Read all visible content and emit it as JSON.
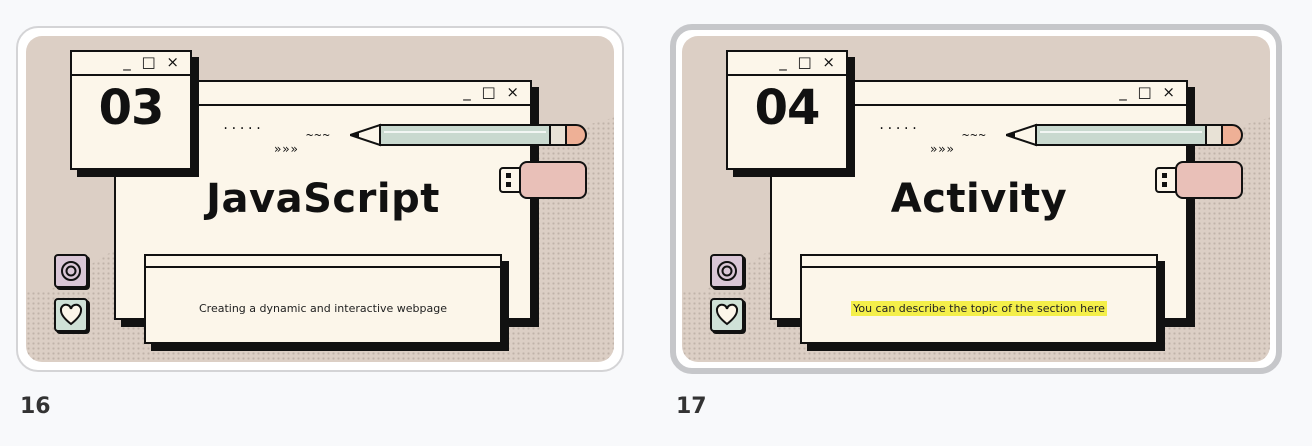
{
  "slides": [
    {
      "number_label": "16",
      "section_number": "03",
      "title": "JavaScript",
      "subtitle": "Creating a dynamic and interactive webpage",
      "selected": false
    },
    {
      "number_label": "17",
      "section_number": "04",
      "title": "Activity",
      "subtitle": "You can describe the topic of the section here",
      "selected": true
    }
  ],
  "window_controls": "_ □ ×",
  "deco": {
    "dots": ".....",
    "arrows": "»»»",
    "wave": "~~~"
  },
  "colors": {
    "slide_bg": "#dccfc5",
    "window_bg": "#fcf6ea",
    "highlight": "#f4ef4a",
    "pencil_body": "#c9d9cf",
    "usb_pink": "#e9c0b8",
    "icon_purple": "#d9c6d6",
    "icon_green": "#cfe1d7"
  },
  "icons": [
    "target-icon",
    "heart-icon",
    "pencil-icon",
    "usb-drive-icon"
  ]
}
